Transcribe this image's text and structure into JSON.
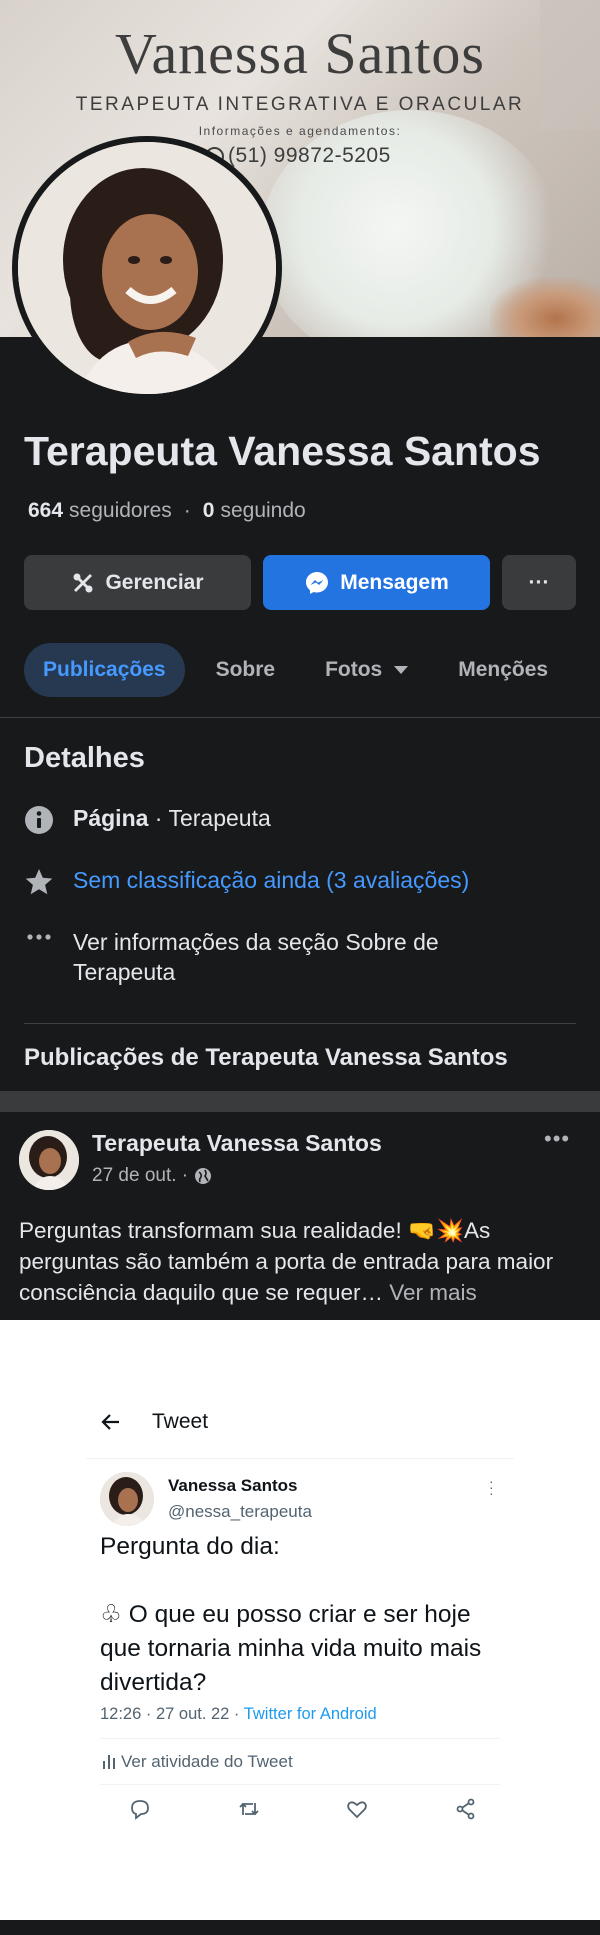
{
  "cover": {
    "brand_name": "Vanessa Santos",
    "brand_subtitle": "TERAPEUTA INTEGRATIVA E ORACULAR",
    "brand_info": "Informações e agendamentos:",
    "brand_phone": "(51) 99872-5205"
  },
  "profile": {
    "name": "Terapeuta Vanessa Santos",
    "followers_count": "664",
    "followers_label": "seguidores",
    "following_count": "0",
    "following_label": "seguindo"
  },
  "actions": {
    "manage_label": "Gerenciar",
    "message_label": "Mensagem",
    "more_label": "···"
  },
  "tabs": [
    {
      "label": "Publicações",
      "active": true
    },
    {
      "label": "Sobre"
    },
    {
      "label": "Fotos"
    },
    {
      "label": "Menções"
    }
  ],
  "details": {
    "title": "Detalhes",
    "page_label": "Página",
    "page_category": " · Terapeuta",
    "rating_text": "Sem classificação ainda (3 avaliações)",
    "about_text": "Ver informações da seção Sobre de Terapeuta"
  },
  "posts_heading": "Publicações de Terapeuta Vanessa Santos",
  "post": {
    "author": "Terapeuta Vanessa Santos",
    "date": "27 de out. ·",
    "text": "Perguntas transformam sua realidade! 🤜💥As perguntas são também a porta de entrada para maior consciência daquilo que se requer…",
    "see_more": "Ver mais"
  },
  "tweet": {
    "header": "Tweet",
    "name": "Vanessa Santos",
    "handle": "@nessa_terapeuta",
    "text": "Pergunta do dia:\n\n♧ O que eu posso criar e ser hoje que tornaria minha vida muito mais divertida?",
    "meta": "12:26 · 27 out. 22 · ",
    "source": "Twitter for Android",
    "activity": "Ver atividade do Tweet"
  },
  "colors": {
    "background": "#18191a",
    "accent": "#2374e1",
    "link": "#4599ff",
    "twitter_blue": "#1d9bf0"
  }
}
